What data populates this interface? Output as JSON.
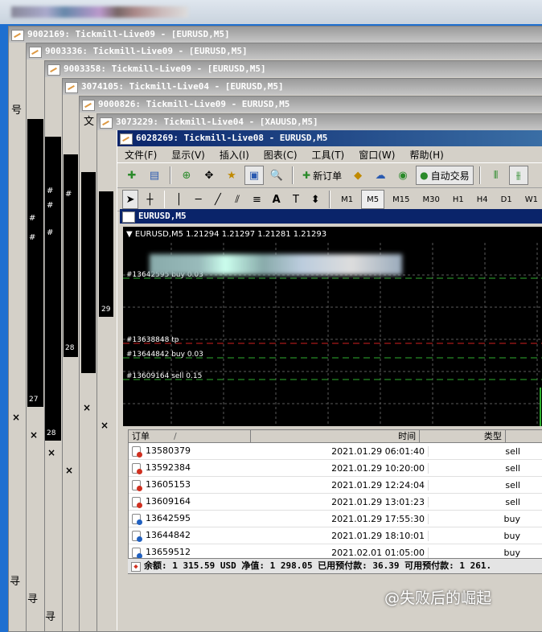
{
  "stack_windows": [
    {
      "title": "9002169: Tickmill-Live09 - [EURUSD,M5]"
    },
    {
      "title": "9003336: Tickmill-Live09 - [EURUSD,M5]"
    },
    {
      "title": "9003358: Tickmill-Live09 - [EURUSD,M5]"
    },
    {
      "title": "3074105: Tickmill-Live04 - [EURUSD,M5]"
    },
    {
      "title": "9000826: Tickmill-Live09 - EURUSD,M5"
    },
    {
      "title": "3073229: Tickmill-Live04 - [XAUUSD,M5]"
    }
  ],
  "bg_labels": {
    "n27": "27",
    "n28a": "28",
    "n28b": "28",
    "n29": "29",
    "close": "×",
    "find1": "寻",
    "find2": "寻",
    "find3": "寻",
    "text_wen": "文",
    "text_hao": "号"
  },
  "main": {
    "title": "6028269: Tickmill-Live08 - EURUSD,M5",
    "menu": [
      "文件(F)",
      "显示(V)",
      "插入(I)",
      "图表(C)",
      "工具(T)",
      "窗口(W)",
      "帮助(H)"
    ],
    "toolbar": {
      "new_order": "新订单",
      "auto_trade": "自动交易"
    },
    "timeframes": [
      "M1",
      "M5",
      "M15",
      "M30",
      "H1",
      "H4",
      "D1",
      "W1"
    ],
    "active_timeframe": "M5",
    "chart_window_title": "EURUSD,M5",
    "chart_header": "EURUSD,M5  1.21294 1.21297 1.21281 1.21293",
    "chart_lines": [
      {
        "label": "#13642595 buy 0.03",
        "color": "#2fae2f"
      },
      {
        "label": "#13638848 tp",
        "color": "#d02020"
      },
      {
        "label": "#13644842 buy 0.03",
        "color": "#2fae2f"
      },
      {
        "label": "#13609164 sell 0.15",
        "color": "#2fae2f"
      }
    ]
  },
  "orders": {
    "headers": {
      "order": "订单",
      "sort": "/",
      "time": "时间",
      "type": "类型"
    },
    "rows": [
      {
        "id": "13580379",
        "time": "2021.01.29 06:01:40",
        "type": "sell"
      },
      {
        "id": "13592384",
        "time": "2021.01.29 10:20:00",
        "type": "sell"
      },
      {
        "id": "13605153",
        "time": "2021.01.29 12:24:04",
        "type": "sell"
      },
      {
        "id": "13609164",
        "time": "2021.01.29 13:01:23",
        "type": "sell"
      },
      {
        "id": "13642595",
        "time": "2021.01.29 17:55:30",
        "type": "buy"
      },
      {
        "id": "13644842",
        "time": "2021.01.29 18:10:01",
        "type": "buy"
      },
      {
        "id": "13659512",
        "time": "2021.02.01 01:05:00",
        "type": "buy"
      }
    ],
    "summary": "余额: 1 315.59 USD  净值: 1 298.05  已用预付款: 36.39  可用预付款: 1 261."
  },
  "watermark": "@失败后的崛起",
  "colors": {
    "sell_dot": "#d03020",
    "buy_dot": "#2060c0",
    "title_active": "#0a246a"
  }
}
